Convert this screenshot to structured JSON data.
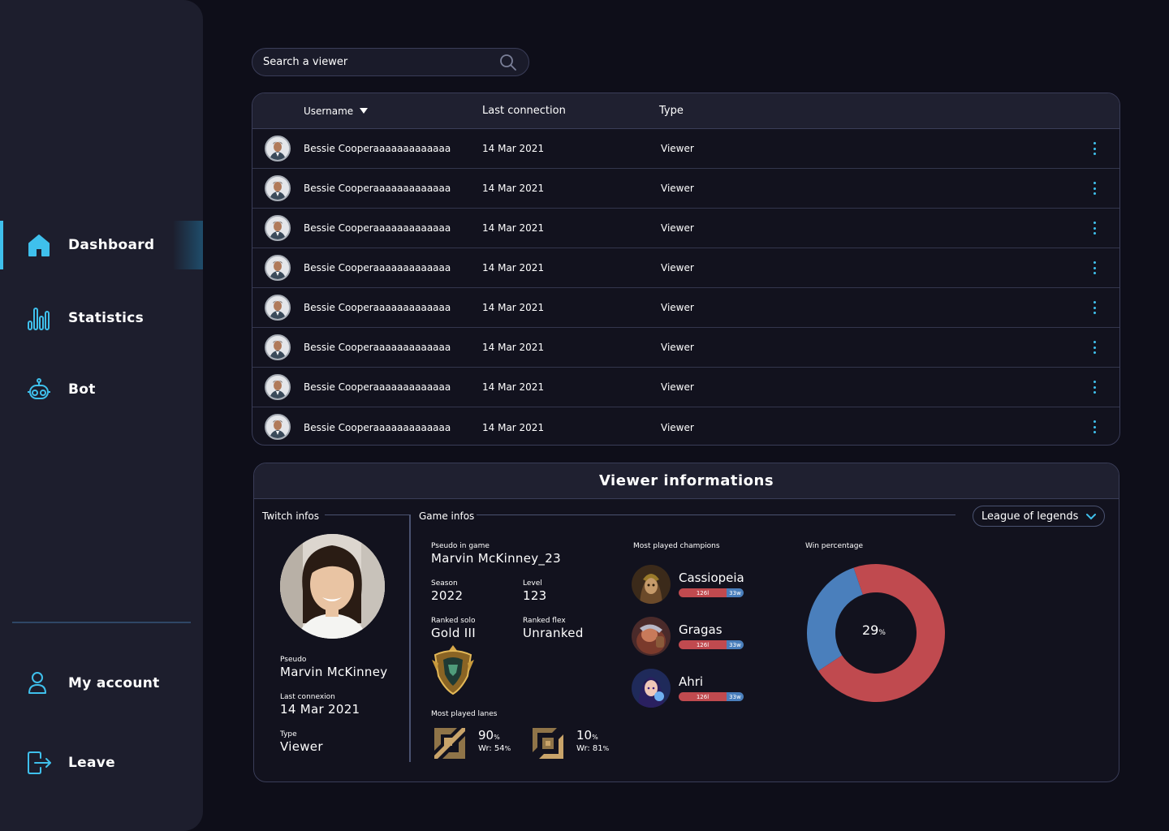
{
  "sidebar": {
    "nav": [
      {
        "label": "Dashboard",
        "icon": "home-icon",
        "active": true
      },
      {
        "label": "Statistics",
        "icon": "bar-chart-icon",
        "active": false
      },
      {
        "label": "Bot",
        "icon": "robot-icon",
        "active": false
      }
    ],
    "bottom": [
      {
        "label": "My account",
        "icon": "user-icon"
      },
      {
        "label": "Leave",
        "icon": "logout-icon"
      }
    ]
  },
  "search": {
    "placeholder": "Search a viewer"
  },
  "table": {
    "headers": {
      "username": "Username",
      "last_connection": "Last connection",
      "type": "Type"
    },
    "rows": [
      {
        "username": "Bessie Cooperaaaaaaaaaaaaa",
        "last_connection": "14 Mar 2021",
        "type": "Viewer"
      },
      {
        "username": "Bessie Cooperaaaaaaaaaaaaa",
        "last_connection": "14 Mar 2021",
        "type": "Viewer"
      },
      {
        "username": "Bessie Cooperaaaaaaaaaaaaa",
        "last_connection": "14 Mar 2021",
        "type": "Viewer"
      },
      {
        "username": "Bessie Cooperaaaaaaaaaaaaa",
        "last_connection": "14 Mar 2021",
        "type": "Viewer"
      },
      {
        "username": "Bessie Cooperaaaaaaaaaaaaa",
        "last_connection": "14 Mar 2021",
        "type": "Viewer"
      },
      {
        "username": "Bessie Cooperaaaaaaaaaaaaa",
        "last_connection": "14 Mar 2021",
        "type": "Viewer"
      },
      {
        "username": "Bessie Cooperaaaaaaaaaaaaa",
        "last_connection": "14 Mar 2021",
        "type": "Viewer"
      },
      {
        "username": "Bessie Cooperaaaaaaaaaaaaa",
        "last_connection": "14 Mar 2021",
        "type": "Viewer"
      }
    ]
  },
  "viewer": {
    "title": "Viewer informations",
    "twitch": {
      "section": "Twitch infos",
      "pseudo_label": "Pseudo",
      "pseudo": "Marvin McKinney",
      "last_label": "Last connexion",
      "last": "14 Mar 2021",
      "type_label": "Type",
      "type": "Viewer"
    },
    "game": {
      "section": "Game infos",
      "selected_game": "League of legends",
      "pseudo_label": "Pseudo in game",
      "pseudo": "Marvin McKinney_23",
      "season_label": "Season",
      "season": "2022",
      "level_label": "Level",
      "level": "123",
      "solo_label": "Ranked solo",
      "solo": "Gold III",
      "flex_label": "Ranked flex",
      "flex": "Unranked",
      "lanes_label": "Most played lanes",
      "lanes": [
        {
          "icon": "top-lane-icon",
          "pct": "90",
          "pct_unit": "%",
          "wr": "Wr: 54",
          "wr_unit": "%"
        },
        {
          "icon": "mid-lane-icon",
          "pct": "10",
          "pct_unit": "%",
          "wr": "Wr: 81",
          "wr_unit": "%"
        }
      ],
      "champs_label": "Most played champions",
      "champions": [
        {
          "name": "Cassiopeia",
          "losses": "126l",
          "wins": "33w",
          "color": "#6b4a2a"
        },
        {
          "name": "Gragas",
          "losses": "126l",
          "wins": "33w",
          "color": "#7a3a2c"
        },
        {
          "name": "Ahri",
          "losses": "126l",
          "wins": "33w",
          "color": "#3a4a8a"
        }
      ],
      "winrate_label": "Win percentage",
      "winrate_value": "29",
      "winrate_unit": "%",
      "winrate_fraction": 0.29,
      "colors": {
        "win": "#4a7fbc",
        "loss": "#c04a4f",
        "accent": "#3fc0ec"
      }
    }
  }
}
